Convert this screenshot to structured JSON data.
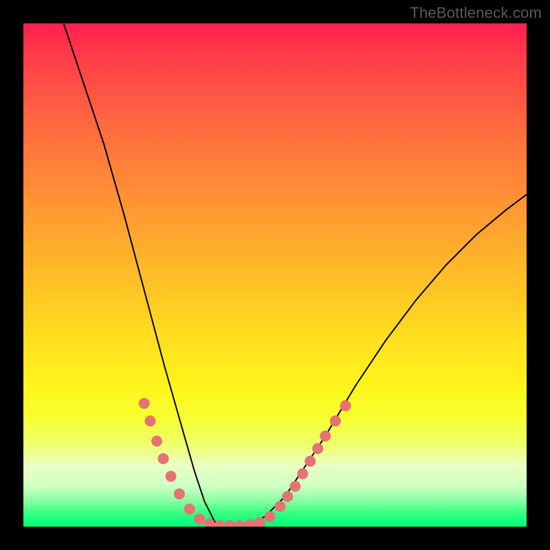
{
  "watermark": "TheBottleneck.com",
  "chart_data": {
    "type": "line",
    "title": "",
    "xlabel": "",
    "ylabel": "",
    "xlim": [
      0,
      100
    ],
    "ylim": [
      0,
      100
    ],
    "grid": false,
    "series": [
      {
        "name": "bottleneck-curve",
        "x": [
          8,
          12,
          16,
          20,
          24,
          28,
          30,
          32,
          34,
          36,
          38,
          40,
          44,
          48,
          52,
          56,
          60,
          66,
          72,
          78,
          84,
          90,
          96,
          100
        ],
        "y": [
          100,
          88,
          76,
          62,
          47,
          32,
          25,
          18,
          11,
          5,
          1,
          0,
          0,
          2,
          6,
          12,
          18,
          28,
          37,
          45,
          52,
          58,
          63,
          66
        ],
        "stroke": "#000000"
      }
    ],
    "markers": {
      "color": "#e57373",
      "left_branch": [
        {
          "x": 24.0,
          "y": 24.5
        },
        {
          "x": 25.2,
          "y": 21.0
        },
        {
          "x": 26.5,
          "y": 17.0
        },
        {
          "x": 27.8,
          "y": 13.5
        },
        {
          "x": 29.3,
          "y": 10.0
        },
        {
          "x": 31.0,
          "y": 6.5
        },
        {
          "x": 33.0,
          "y": 3.5
        },
        {
          "x": 35.0,
          "y": 1.5
        }
      ],
      "bottom": [
        {
          "x": 37.0,
          "y": 0.5
        },
        {
          "x": 39.0,
          "y": 0.2
        },
        {
          "x": 41.0,
          "y": 0.2
        },
        {
          "x": 43.0,
          "y": 0.2
        },
        {
          "x": 45.0,
          "y": 0.4
        },
        {
          "x": 47.0,
          "y": 0.8
        }
      ],
      "right_branch": [
        {
          "x": 49.0,
          "y": 2.0
        },
        {
          "x": 51.0,
          "y": 4.0
        },
        {
          "x": 52.5,
          "y": 6.0
        },
        {
          "x": 54.0,
          "y": 8.0
        },
        {
          "x": 55.5,
          "y": 10.5
        },
        {
          "x": 57.0,
          "y": 13.0
        },
        {
          "x": 58.5,
          "y": 15.5
        },
        {
          "x": 60.0,
          "y": 18.0
        },
        {
          "x": 62.0,
          "y": 21.0
        },
        {
          "x": 64.0,
          "y": 24.0
        }
      ]
    },
    "gradient_stops": [
      {
        "pos": 0,
        "color": "#ff1f4f"
      },
      {
        "pos": 50,
        "color": "#ffc226"
      },
      {
        "pos": 75,
        "color": "#fff51a"
      },
      {
        "pos": 100,
        "color": "#00ff76"
      }
    ]
  }
}
